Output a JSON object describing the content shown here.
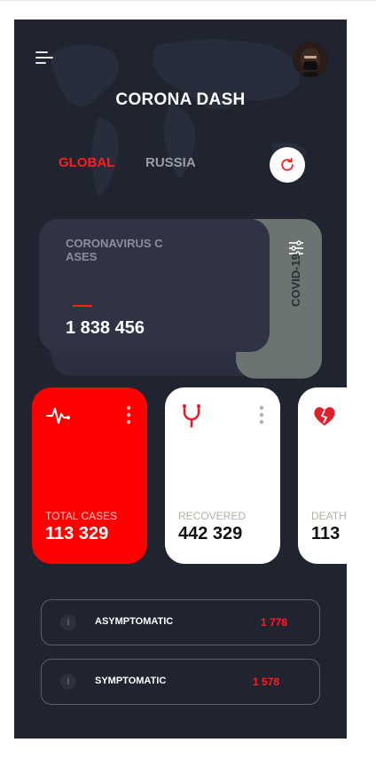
{
  "colors": {
    "background": "#1f2430",
    "accent": "#ff1e1e",
    "card": "#2f3344",
    "side_card": "#6b7470",
    "tab_inactive": "#9a9da6"
  },
  "header": {
    "title": "CORONA DASH",
    "menu_icon": "menu-icon",
    "avatar_icon": "avatar"
  },
  "tabs": [
    {
      "label": "GLOBAL",
      "active": true
    },
    {
      "label": "RUSSIA",
      "active": false
    }
  ],
  "refresh_icon": "refresh-icon",
  "summary_card": {
    "label": "CORONAVIRUS CASES",
    "value": "1 838 456",
    "side_label": "COVID-19",
    "filter_icon": "sliders-icon"
  },
  "stats": [
    {
      "label": "TOTAL CASES",
      "value": "113 329",
      "icon": "heartbeat-icon"
    },
    {
      "label": "RECOVERED",
      "value": "442 329",
      "icon": "stethoscope-icon"
    },
    {
      "label": "DEATHS",
      "value": "113",
      "icon": "broken-heart-icon"
    }
  ],
  "rows": [
    {
      "label": "ASYMPTOMATIC",
      "value": "1 778",
      "info": "i"
    },
    {
      "label": "SYMPTOMATIC",
      "value": "1 578",
      "info": "i"
    }
  ]
}
